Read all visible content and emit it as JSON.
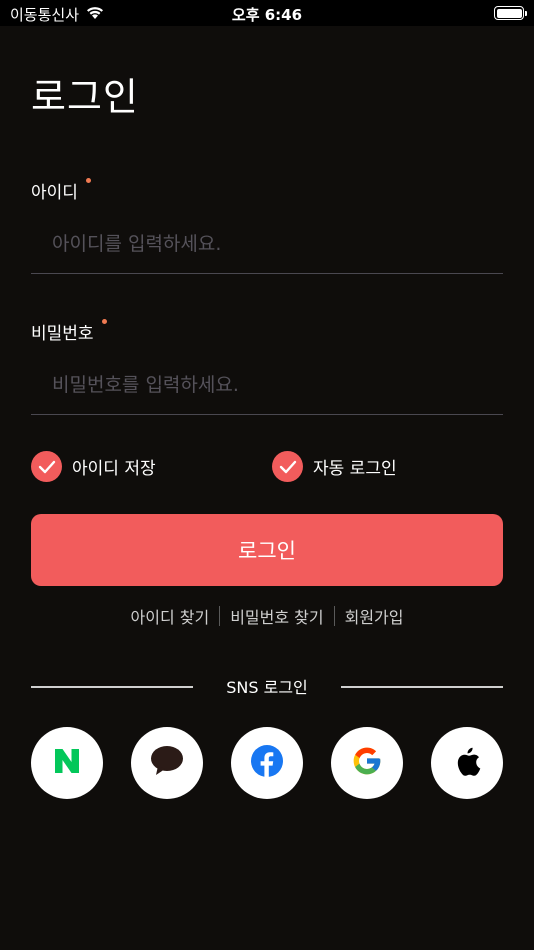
{
  "status_bar": {
    "carrier": "이동통신사",
    "time": "오후 6:46"
  },
  "page": {
    "title": "로그인"
  },
  "form": {
    "id_label": "아이디",
    "id_placeholder": "아이디를 입력하세요.",
    "id_value": "",
    "password_label": "비밀번호",
    "password_placeholder": "비밀번호를 입력하세요.",
    "password_value": "",
    "save_id_label": "아이디 저장",
    "save_id_checked": true,
    "auto_login_label": "자동 로그인",
    "auto_login_checked": true,
    "login_button": "로그인"
  },
  "links": {
    "find_id": "아이디 찾기",
    "find_password": "비밀번호 찾기",
    "sign_up": "회원가입"
  },
  "sns": {
    "label": "SNS 로그인",
    "buttons": [
      {
        "icon": "naver-icon"
      },
      {
        "icon": "kakao-icon"
      },
      {
        "icon": "facebook-icon"
      },
      {
        "icon": "google-icon"
      },
      {
        "icon": "apple-icon"
      }
    ]
  },
  "colors": {
    "background": "#0f0d0b",
    "accent": "#f25c5c",
    "required_dot": "#f07a52",
    "naver": "#03c75a",
    "facebook": "#1877f2"
  }
}
